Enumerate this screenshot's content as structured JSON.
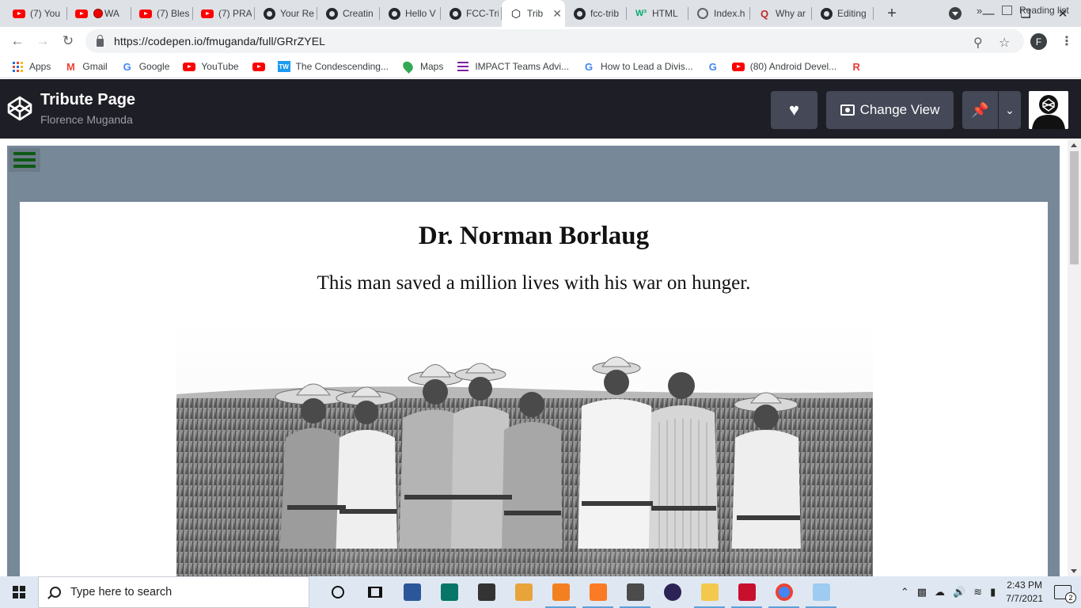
{
  "browser": {
    "tabs": [
      {
        "favicon": "youtube-icon",
        "title": "(7) You"
      },
      {
        "favicon": "youtube-icon",
        "title": "WA"
      },
      {
        "favicon": "youtube-icon",
        "title": "(7) Bles"
      },
      {
        "favicon": "youtube-icon",
        "title": "(7) PRA"
      },
      {
        "favicon": "github-icon",
        "title": "Your Re"
      },
      {
        "favicon": "github-icon",
        "title": "Creatin"
      },
      {
        "favicon": "github-icon",
        "title": "Hello V"
      },
      {
        "favicon": "github-icon",
        "title": "FCC-Tri"
      },
      {
        "favicon": "codepen-icon",
        "title": "Trib"
      },
      {
        "favicon": "github-icon",
        "title": "fcc-trib"
      },
      {
        "favicon": "w3schools-icon",
        "title": "HTML"
      },
      {
        "favicon": "globe-icon",
        "title": "Index.h"
      },
      {
        "favicon": "quora-icon",
        "title": "Why ar"
      },
      {
        "favicon": "github-icon",
        "title": "Editing"
      }
    ],
    "active_tab_index": 8,
    "new_tab_glyph": "+",
    "url": "https://codepen.io/fmuganda/full/GRrZYEL",
    "profile_initial": "F",
    "bookmarks": [
      {
        "icon": "apps-grid-icon",
        "label": "Apps"
      },
      {
        "icon": "gmail-icon",
        "label": "Gmail"
      },
      {
        "icon": "google-icon",
        "label": "Google"
      },
      {
        "icon": "youtube-icon",
        "label": "YouTube"
      },
      {
        "icon": "youtube-icon",
        "label": ""
      },
      {
        "icon": "tw-icon",
        "label": "The Condescending..."
      },
      {
        "icon": "maps-icon",
        "label": "Maps"
      },
      {
        "icon": "impact-icon",
        "label": "IMPACT Teams Advi..."
      },
      {
        "icon": "google-icon",
        "label": "How to Lead a Divis..."
      },
      {
        "icon": "google-icon",
        "label": ""
      },
      {
        "icon": "youtube-icon",
        "label": "(80) Android Devel..."
      },
      {
        "icon": "r-icon",
        "label": ""
      }
    ],
    "bookmarks_overflow": "»",
    "reading_list_label": "Reading list"
  },
  "codepen": {
    "pen_title": "Tribute Page",
    "author": "Florence Muganda",
    "change_view_label": "Change View"
  },
  "page": {
    "heading": "Dr. Norman Borlaug",
    "tagline": "This man saved a million lives with his war on hunger."
  },
  "taskbar": {
    "search_placeholder": "Type here to search",
    "time": "2:43 PM",
    "date": "7/7/2021",
    "notification_count": "2",
    "pinned_apps": [
      "cortana-icon",
      "task-view-icon",
      "word-icon",
      "publisher-icon",
      "store-icon",
      "media-icon",
      "sublime-s-icon",
      "xampp-icon",
      "sublime-icon",
      "eclipse-icon",
      "file-explorer-icon",
      "typora-icon",
      "chrome-icon",
      "paint-icon"
    ]
  },
  "colors": {
    "codepen_header": "#1e1f26",
    "page_background": "#778899",
    "menu_icon": "#0d5a16"
  }
}
